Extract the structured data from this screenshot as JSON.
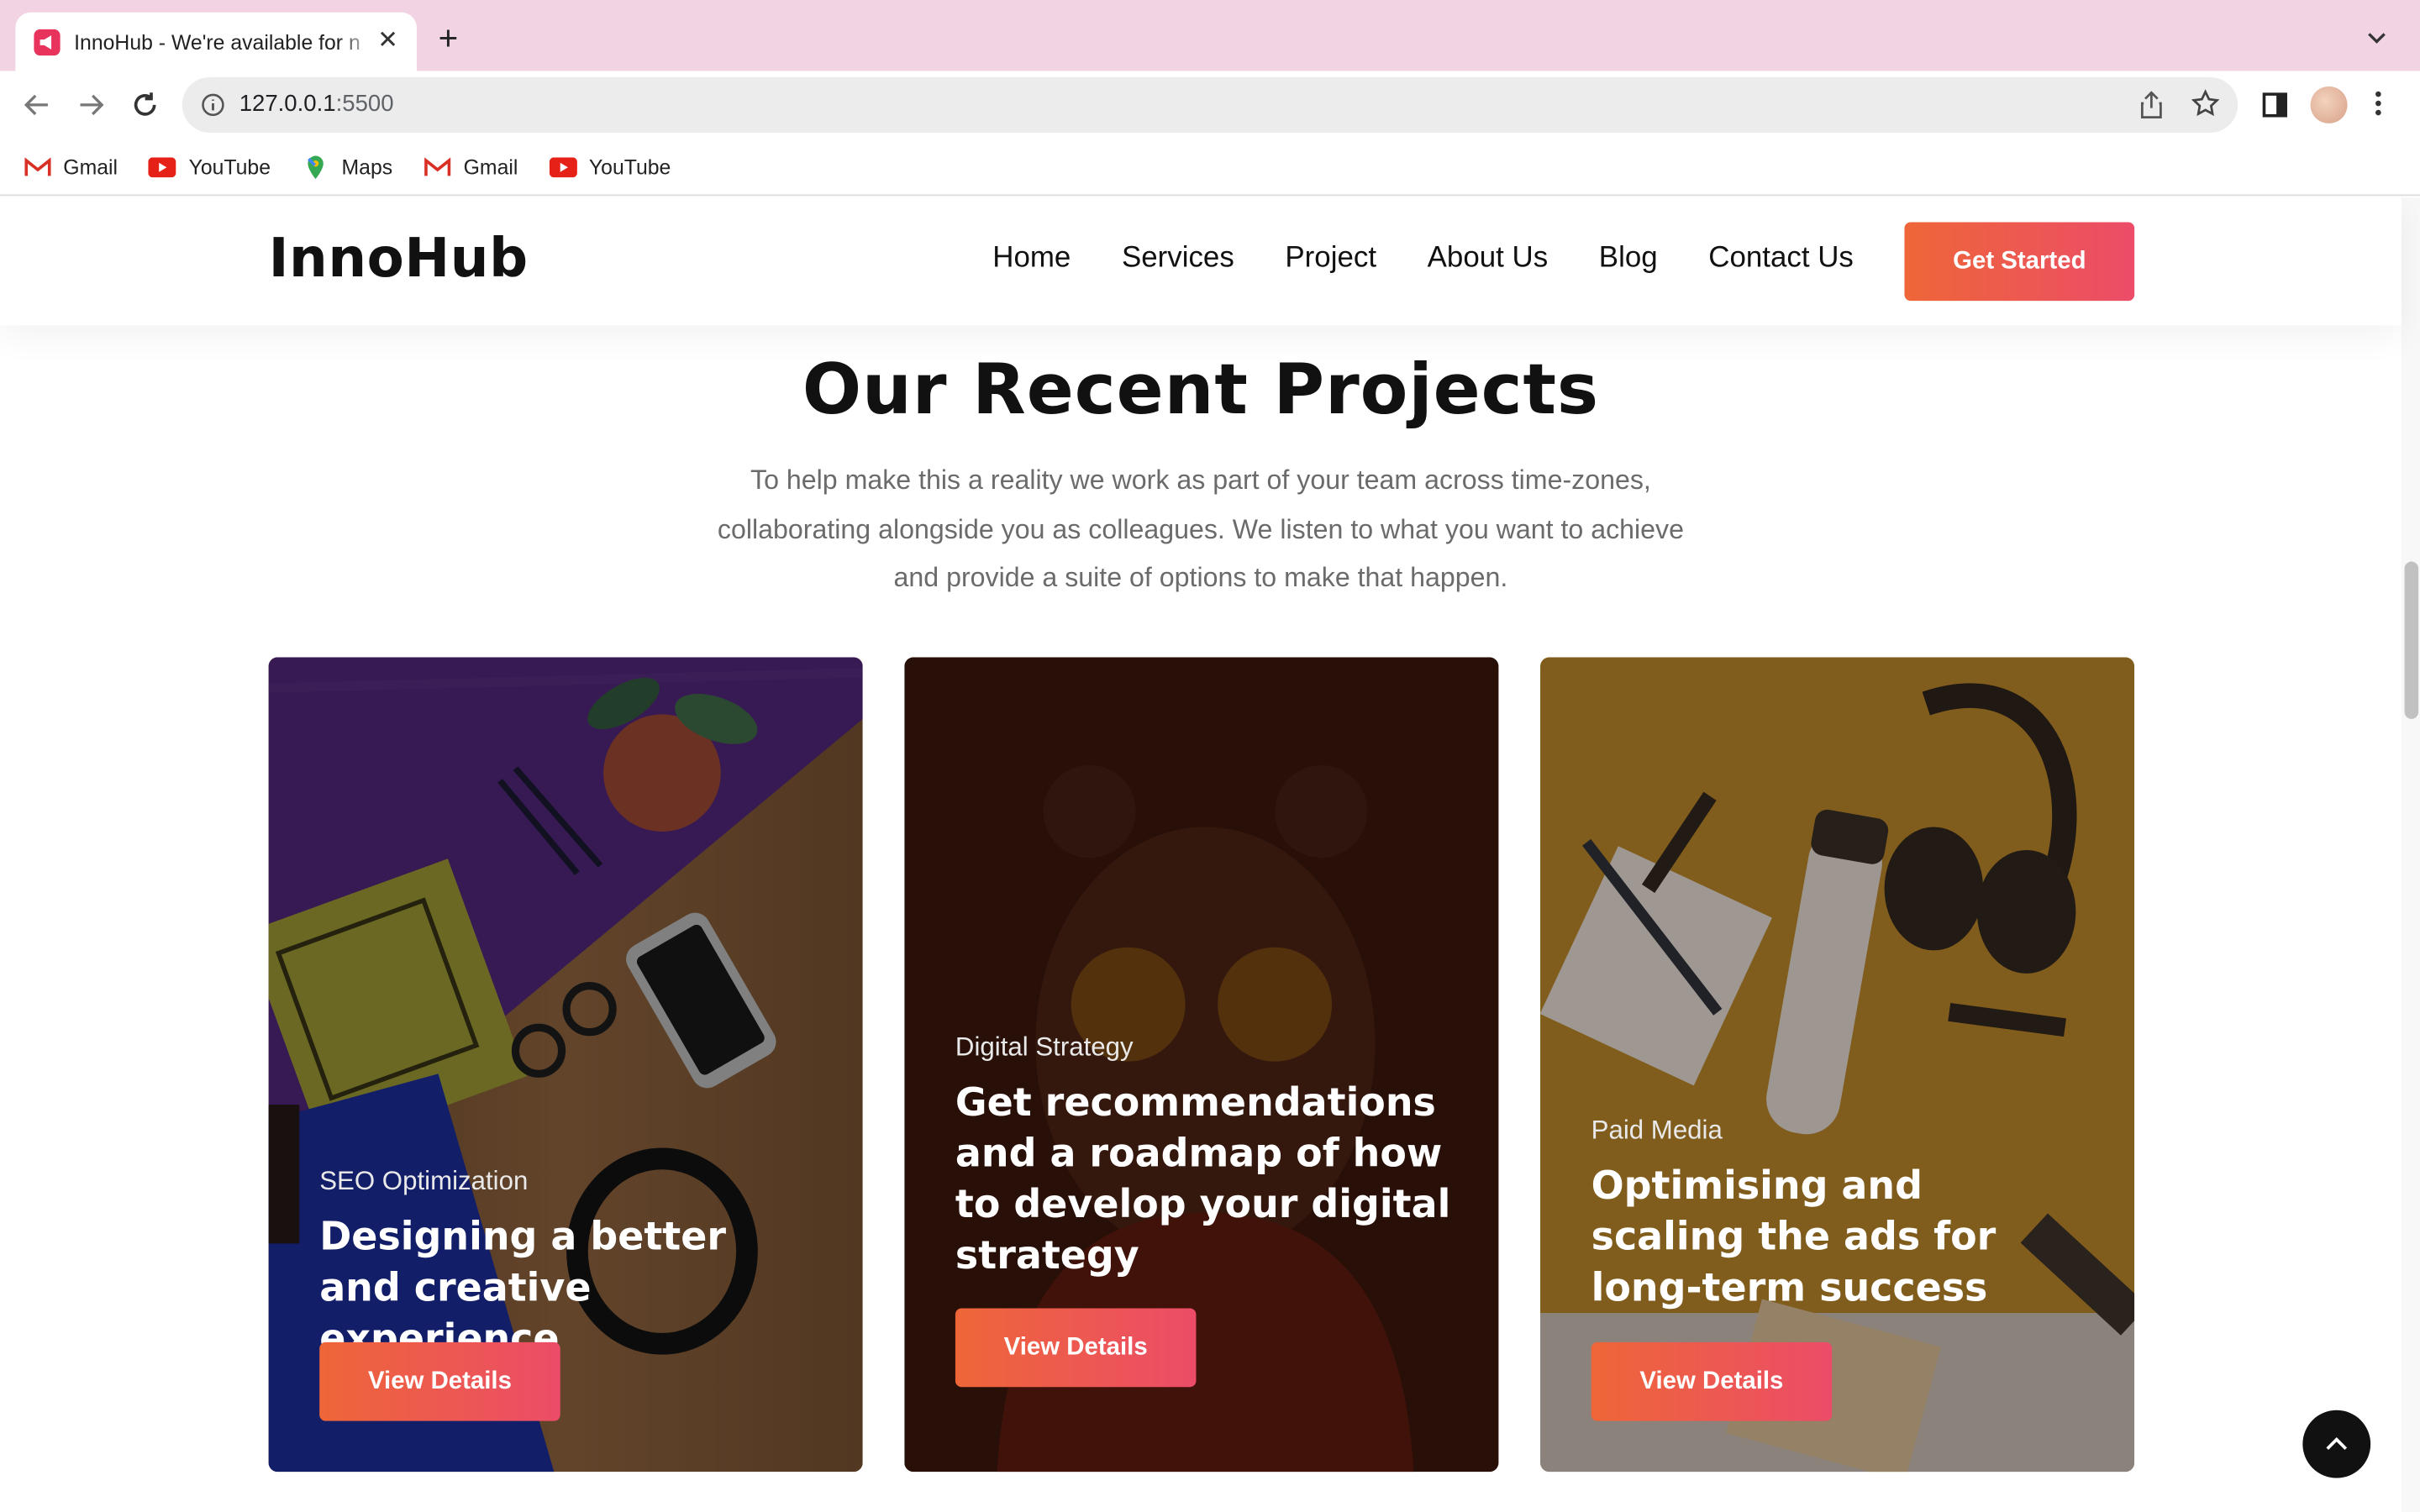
{
  "browser": {
    "tab_title": "InnoHub - We're available for n",
    "url_host": "127.0.0.1",
    "url_port": ":5500",
    "bookmarks": [
      {
        "label": "Gmail",
        "icon": "gmail-icon"
      },
      {
        "label": "YouTube",
        "icon": "youtube-icon"
      },
      {
        "label": "Maps",
        "icon": "maps-icon"
      },
      {
        "label": "Gmail",
        "icon": "gmail-icon"
      },
      {
        "label": "YouTube",
        "icon": "youtube-icon"
      }
    ]
  },
  "header": {
    "logo": "InnoHub",
    "nav": [
      "Home",
      "Services",
      "Project",
      "About Us",
      "Blog",
      "Contact Us"
    ],
    "cta": "Get Started"
  },
  "projects": {
    "title": "Our Recent Projects",
    "description": "To help make this a reality we work as part of your team across time-zones, collaborating alongside you as colleagues. We listen to what you want to achieve and provide a suite of options to make that happen.",
    "cards": [
      {
        "category": "SEO Optimization",
        "title": "Designing a better and creative experience",
        "button": "View Details"
      },
      {
        "category": "Digital Strategy",
        "title": "Get recommendations and a roadmap of how to develop your digital strategy",
        "button": "View Details"
      },
      {
        "category": "Paid Media",
        "title": "Optimising and scaling the ads for long-term success",
        "button": "View Details"
      }
    ]
  },
  "colors": {
    "accent_start": "#ee6638",
    "accent_end": "#ec4c68",
    "tabbar": "#f2d3e3"
  },
  "icons": {
    "back_to_top": "chevron-up-icon"
  }
}
